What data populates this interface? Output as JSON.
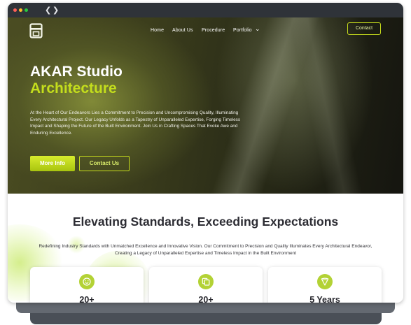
{
  "browser": {
    "back_icon": "chevron-left-icon",
    "forward_icon": "chevron-right-icon"
  },
  "colors": {
    "accent": "#c4de1c",
    "hero_dark": "#2b2d18",
    "heading_text": "#2c2c33",
    "icon_circle": "#b3d235"
  },
  "navbar": {
    "logo_icon": "studio-logo-icon",
    "links": [
      "Home",
      "About Us",
      "Procedure",
      "Portfolio"
    ],
    "portfolio_dropdown_icon": "chevron-down-icon",
    "contact_label": "Contact"
  },
  "hero": {
    "title": "AKAR Studio",
    "subtitle": "Architecture",
    "description": " At the Heart of Our Endeavors Lies a Commitment to Precision and Uncompromising Quality, Illuminating Every Architectural Project. Our Legacy Unfolds as a Tapestry of Unparalleled Expertise, Forging Timeless Impact and Shaping the Future of the Built Environment. Join Us in Crafting Spaces That Evoke Awe and Enduring Excellence.",
    "more_info_label": "More Info",
    "contact_us_label": "Contact Us"
  },
  "section": {
    "title": "Elevating Standards, Exceeding Expectations",
    "description": "Redefining Industry Standards with Unmatched Excellence and Innovative Vision. Our Commitment to Precision and Quality Illuminates Every Architectural Endeavor, Creating a Legacy of Unparalleled Expertise and Timeless Impact in the Built Environment",
    "cards": [
      {
        "icon": "smiley-icon",
        "value": "20+"
      },
      {
        "icon": "copy-icon",
        "value": "20+"
      },
      {
        "icon": "pizza-slice-icon",
        "value": "5 Years"
      }
    ]
  }
}
